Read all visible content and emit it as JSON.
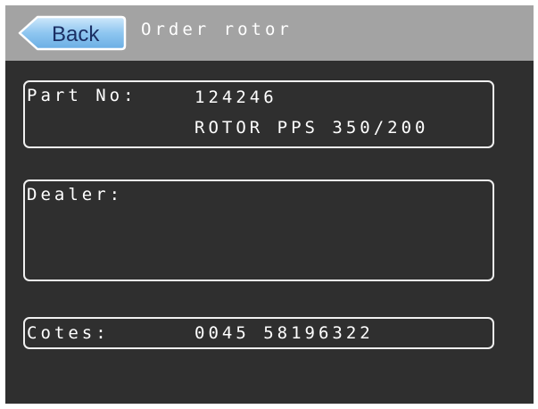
{
  "header": {
    "back_label": "Back",
    "title": "Order rotor"
  },
  "part": {
    "label": "Part No:",
    "number": "124246",
    "description": "ROTOR PPS 350/200"
  },
  "dealer": {
    "label": "Dealer:",
    "value": ""
  },
  "cotes": {
    "label": "Cotes:",
    "value": "0045 58196322"
  },
  "colors": {
    "screen_background": "#2f2f2f",
    "title_bar": "#a3a3a3",
    "back_button_fill": "#8ec6f0",
    "text": "#ffffff"
  }
}
